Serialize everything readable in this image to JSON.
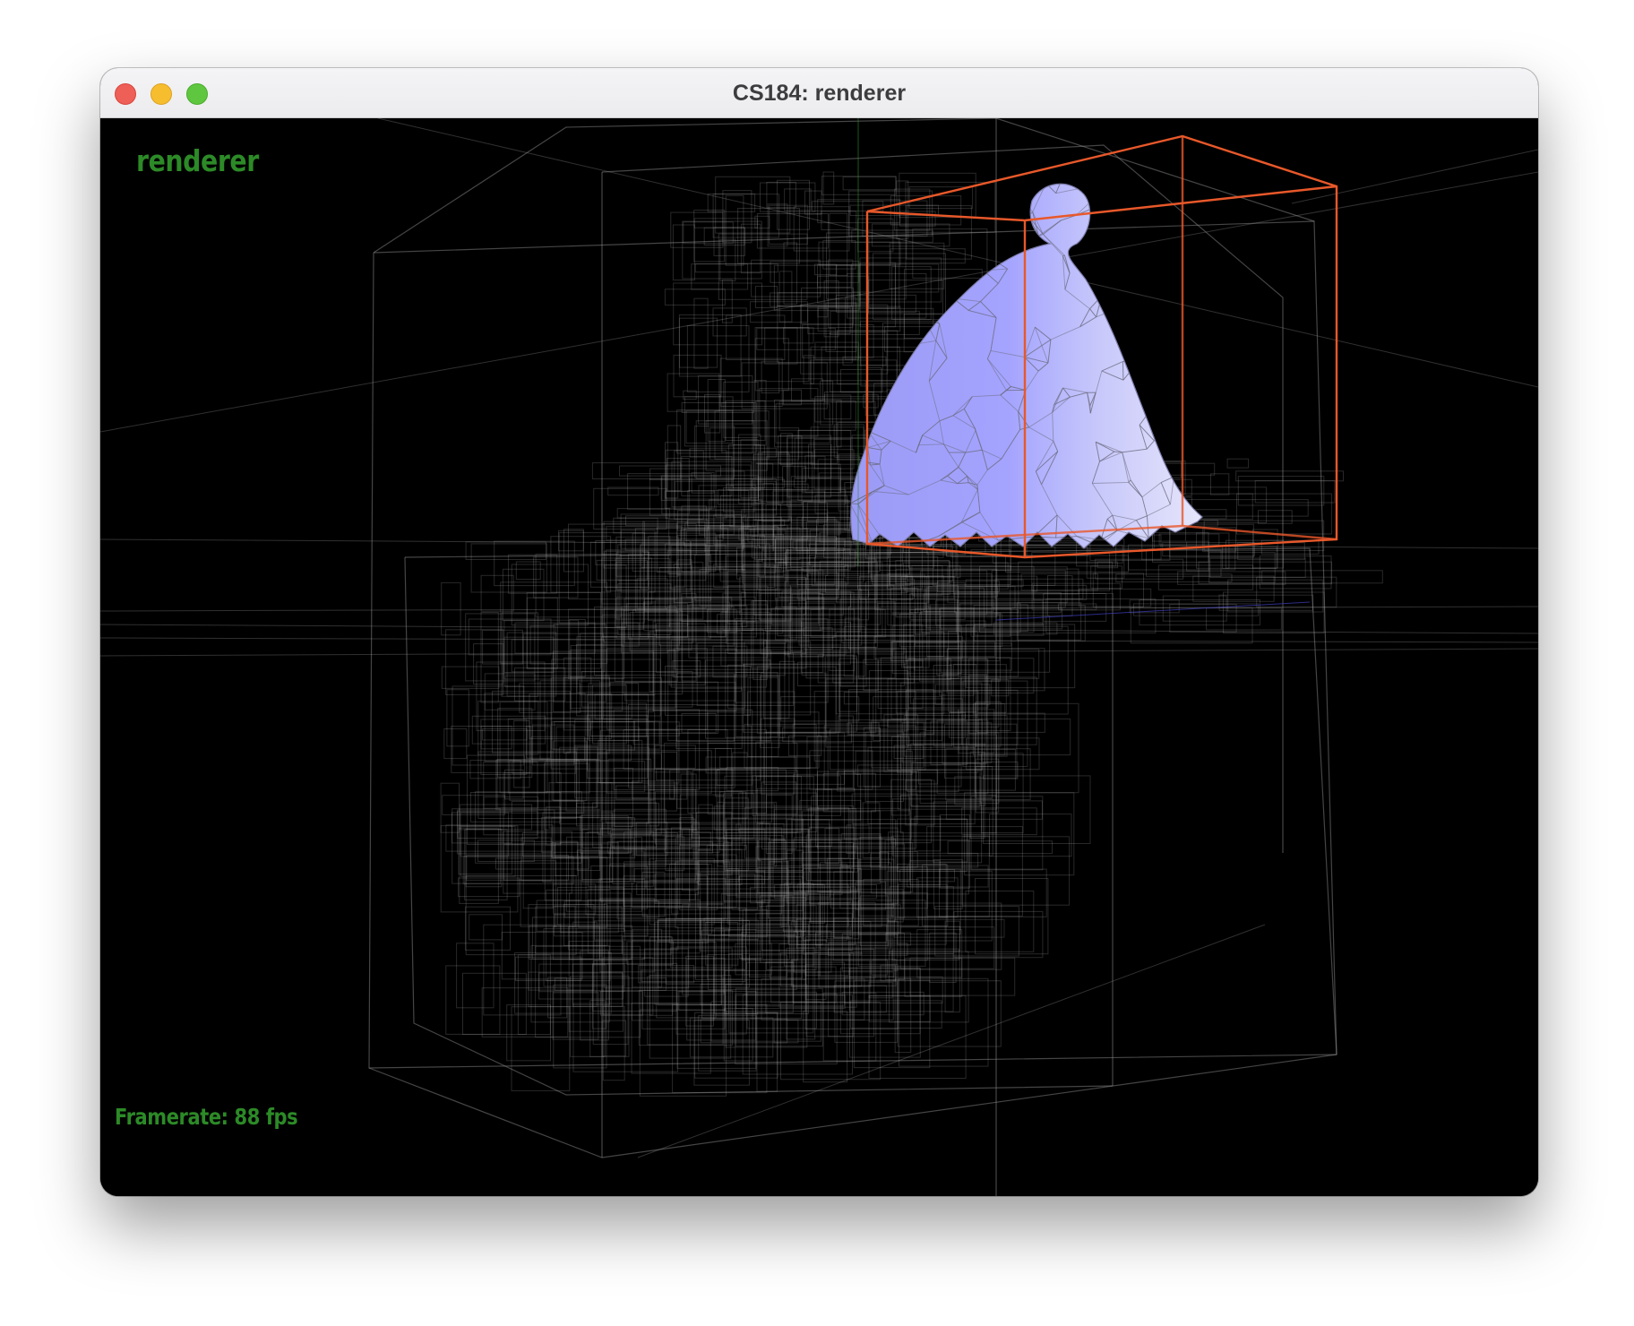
{
  "window": {
    "title": "CS184: renderer"
  },
  "overlay": {
    "app_label": "renderer",
    "framerate_label": "Framerate: 88 fps"
  },
  "colors": {
    "background": "#000000",
    "bvh_boxes": "#9a9a9a",
    "selected_box": "#e8582a",
    "mesh_fill": "#a7a7f7",
    "overlay_text": "#2c8a27"
  }
}
